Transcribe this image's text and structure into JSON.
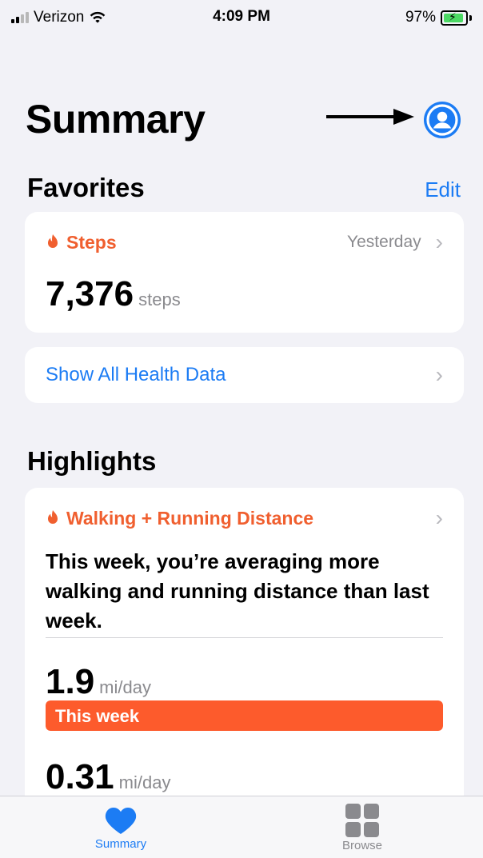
{
  "status_bar": {
    "carrier": "Verizon",
    "time": "4:09 PM",
    "battery": "97%",
    "battery_fraction": 0.97,
    "signal_strength": 2
  },
  "header": {
    "title": "Summary",
    "profile_icon": "person-circle-icon",
    "arrow_icon": "arrow-right-icon"
  },
  "favorites": {
    "section_title": "Favorites",
    "edit_label": "Edit",
    "steps_card": {
      "title": "Steps",
      "timestamp": "Yesterday",
      "value": "7,376",
      "unit": "steps",
      "icon": "flame-icon"
    },
    "show_all_label": "Show All Health Data"
  },
  "highlights": {
    "section_title": "Highlights",
    "card": {
      "title": "Walking + Running Distance",
      "summary": "This week, you’re averaging more walking and running distance than last week.",
      "this_week_value": "1.9",
      "this_week_unit": "mi/day",
      "this_week_label": "This week",
      "this_week_fraction": 1.0,
      "last_week_value": "0.31",
      "last_week_unit": "mi/day"
    }
  },
  "tab_bar": {
    "summary_label": "Summary",
    "browse_label": "Browse"
  },
  "colors": {
    "accent_blue": "#1c7cf4",
    "activity_orange": "#f05f2f",
    "highlight_bar": "#fd5b2c",
    "battery_green": "#4cd964",
    "background": "#f2f2f7"
  }
}
